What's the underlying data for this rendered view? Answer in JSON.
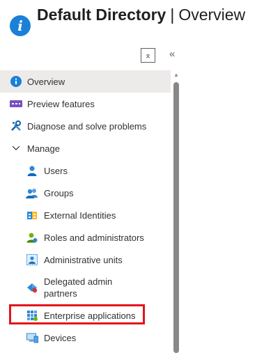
{
  "header": {
    "title": "Default Directory",
    "separator": "|",
    "subtitle": "Overview",
    "icon": "info-icon"
  },
  "controls": {
    "collapse_icon": "collapse-icon",
    "collapse_glyph": "⌅",
    "double_chevron_glyph": "«"
  },
  "nav": {
    "items": [
      {
        "label": "Overview",
        "icon": "info-icon",
        "active": true
      },
      {
        "label": "Preview features",
        "icon": "preview-features-icon"
      },
      {
        "label": "Diagnose and solve problems",
        "icon": "wrench-screwdriver-icon"
      },
      {
        "label": "Manage",
        "icon": "chevron-down-icon",
        "expanded": true
      },
      {
        "label": "Users",
        "icon": "user-icon"
      },
      {
        "label": "Groups",
        "icon": "groups-icon"
      },
      {
        "label": "External Identities",
        "icon": "external-identities-icon"
      },
      {
        "label": "Roles and administrators",
        "icon": "roles-icon"
      },
      {
        "label": "Administrative units",
        "icon": "administrative-units-icon"
      },
      {
        "label": "Delegated admin partners",
        "icon": "delegated-admin-icon"
      },
      {
        "label": "Enterprise applications",
        "icon": "enterprise-apps-icon",
        "highlighted": true
      },
      {
        "label": "Devices",
        "icon": "devices-icon"
      }
    ]
  },
  "colors": {
    "accent": "#0078d4",
    "highlight_border": "#e3141b",
    "active_bg": "#edebe9"
  }
}
